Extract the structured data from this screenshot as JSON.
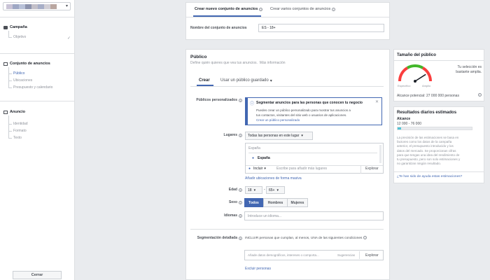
{
  "sidebar": {
    "campaign": {
      "title": "Campaña",
      "items": [
        "Objetivo"
      ]
    },
    "adset": {
      "title": "Conjunto de anuncios",
      "items": [
        "Público",
        "Ubicaciones",
        "Presupuesto y calendario"
      ]
    },
    "ad": {
      "title": "Anuncio",
      "items": [
        "Identidad",
        "Formato",
        "Texto"
      ]
    },
    "close_label": "Cerrar"
  },
  "top_tabs": {
    "create_new": "Crear nuevo conjunto de anuncios",
    "create_multiple": "Crear varios conjuntos de anuncios"
  },
  "adset_name": {
    "label": "Nombre del conjunto de anuncios",
    "value": "ES - 18+"
  },
  "audience": {
    "title": "Público",
    "subtitle": "Define quién quieres que vea tus anuncios.",
    "more_info": "Más información",
    "tab_create": "Crear",
    "tab_saved": "Usar un público guardado",
    "custom_audiences_label": "Públicos personalizados",
    "notice_title": "Segmentar anuncios para las personas que conocen tu negocio",
    "notice_body_1": "Puedes crear un público personalizado para mostrar tus anuncios a",
    "notice_body_2": "tus contactos, visitantes del sitio web o usuarios de aplicaciones.",
    "notice_link": "Crear un público personalizado",
    "locations_label": "Lugares",
    "locations_dropdown": "Todas las personas en este lugar",
    "location_country": "España",
    "location_selected": "España",
    "include_label": "Incluir",
    "location_placeholder": "Escribe para añadir más lugares",
    "explore_label": "Explorar",
    "bulk_link": "Añadir ubicaciones de forma masiva",
    "age_label": "Edad",
    "age_min": "18",
    "age_max": "65+",
    "age_dash": "-",
    "gender_label": "Sexo",
    "gender_options": [
      "Todos",
      "Hombres",
      "Mujeres"
    ],
    "languages_label": "Idiomas",
    "languages_placeholder": "Introduce un idioma...",
    "detailed_label": "Segmentación detallada",
    "detailed_include": "INCLUIR personas que cumplan, al menos, UNA de las siguientes condiciones",
    "detailed_placeholder": "Añade datos demográficos, intereses o comporta...",
    "suggestions_label": "Sugerencias",
    "detailed_explore": "Explorar",
    "exclude_link": "Excluir personas"
  },
  "audience_size": {
    "title": "Tamaño del público",
    "specific": "Específico",
    "broad": "Amplio",
    "status_1": "Tu selección es",
    "status_2": "bastante amplia.",
    "reach": "Alcance potencial: 27 000 000 personas",
    "gauge_fraction": 0.82
  },
  "daily_results": {
    "title": "Resultados diarios estimados",
    "reach_label": "Alcance",
    "reach_range": "12 000 - 76 000",
    "reach_fill_fraction": 0.05,
    "body": [
      "La precisión de las estimaciones se basa en",
      "factores como los datos de la campaña",
      "anterior, el presupuesto introducido y los",
      "datos del mercado. Se proporcionan cifras",
      "para que tengas una idea del rendimiento de",
      "tu presupuesto, pero son solo estimaciones y",
      "no garantizan ningún resultado."
    ],
    "help_link": "¿Te han sido de ayuda estas estimaciones?"
  },
  "colors": {
    "accent": "#4267b2",
    "gauge_green": "#42b72a",
    "gauge_yellow": "#f7b928",
    "gauge_red": "#fa3e3e"
  }
}
